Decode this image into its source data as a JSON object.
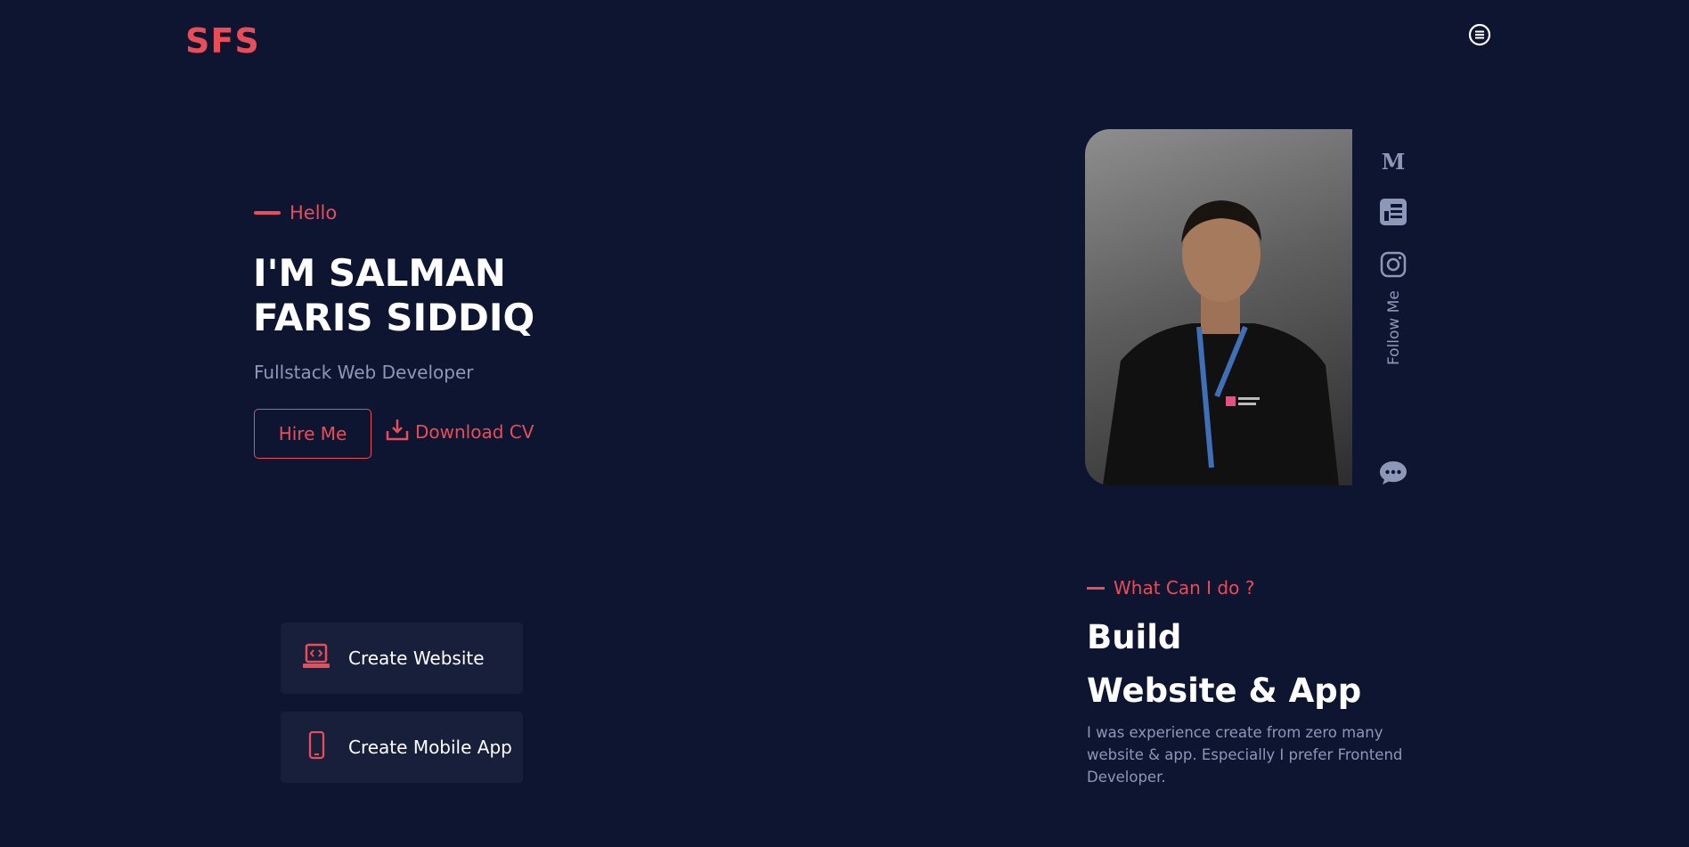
{
  "header": {
    "logo": "SFS",
    "menu_icon": "menu-icon"
  },
  "hero": {
    "greeting": "Hello",
    "name_line1": "I'M SALMAN",
    "name_line2": "FARIS SIDDIQ",
    "role": "Fullstack Web Developer",
    "hire_label": "Hire Me",
    "download_label": "Download CV",
    "download_icon": "download-icon"
  },
  "social": {
    "icons": [
      "medium-icon",
      "news-icon",
      "instagram-icon"
    ],
    "follow_label": "Follow Me",
    "chat_icon": "chat-icon"
  },
  "services": {
    "items": [
      {
        "label": "Create Website",
        "icon": "laptop-code-icon"
      },
      {
        "label": "Create Mobile App",
        "icon": "mobile-icon"
      }
    ]
  },
  "about": {
    "eyebrow": "What Can I do ?",
    "title_line1": "Build",
    "title_line2": "Website & App",
    "description": "I was experience create from zero many website & app. Especially I prefer Frontend Developer."
  },
  "colors": {
    "background": "#0e1530",
    "accent": "#ea4c58",
    "muted_text": "#8d97b8",
    "card": "#181f3b"
  }
}
